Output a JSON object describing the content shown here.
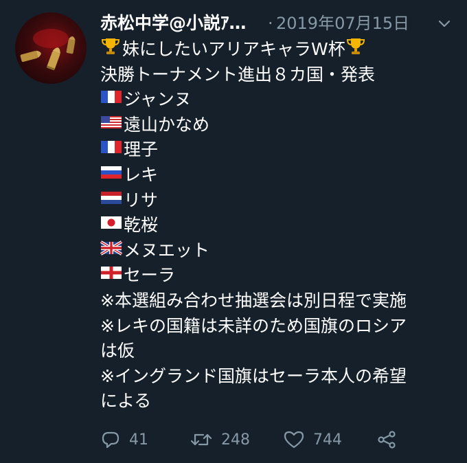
{
  "tweet": {
    "display_name": "赤松中学@小説ｱ…",
    "separator": "·",
    "date": "2019年07月15日",
    "caret_icon": "chevron-down-icon",
    "lines": [
      {
        "icon": "trophy",
        "text": "妹にしたいアリアキャラW杯",
        "suffix": "trophy"
      },
      {
        "icon": "",
        "text": "決勝トーナメント進出８カ国・発表"
      },
      {
        "icon": "flag-france",
        "text": "ジャンヌ"
      },
      {
        "icon": "flag-usa",
        "text": "遠山かなめ"
      },
      {
        "icon": "flag-france",
        "text": "理子"
      },
      {
        "icon": "flag-russia",
        "text": "レキ"
      },
      {
        "icon": "flag-netherlands",
        "text": "リサ"
      },
      {
        "icon": "flag-japan",
        "text": "乾桜"
      },
      {
        "icon": "flag-uk",
        "text": "メヌエット"
      },
      {
        "icon": "flag-england",
        "text": "セーラ"
      },
      {
        "icon": "",
        "text": "※本選組み合わせ抽選会は別日程で実施"
      },
      {
        "icon": "",
        "text": "※レキの国籍は未詳のため国旗のロシア"
      },
      {
        "icon": "",
        "text": "は仮"
      },
      {
        "icon": "",
        "text": "※イングランド国旗はセーラ本人の希望"
      },
      {
        "icon": "",
        "text": "による"
      }
    ],
    "actions": {
      "reply": {
        "icon": "reply-icon",
        "count": "41"
      },
      "retweet": {
        "icon": "retweet-icon",
        "count": "248"
      },
      "like": {
        "icon": "heart-icon",
        "count": "744"
      },
      "share": {
        "icon": "share-icon"
      }
    },
    "colors": {
      "background": "#15202b",
      "text": "#ffffff",
      "muted": "#8899a6"
    }
  }
}
